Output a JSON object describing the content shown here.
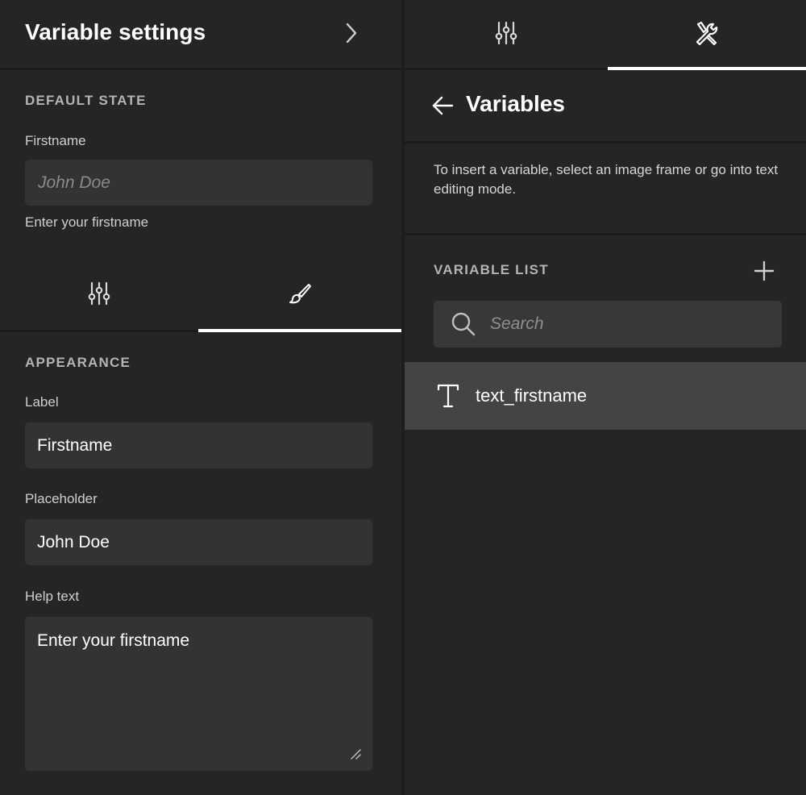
{
  "left_panel": {
    "title": "Variable settings",
    "default_state": {
      "heading": "DEFAULT STATE",
      "label": "Firstname",
      "placeholder": "John Doe",
      "help_text": "Enter your firstname"
    },
    "tabs": [
      {
        "icon": "sliders-icon",
        "active": false
      },
      {
        "icon": "paintbrush-icon",
        "active": true
      }
    ],
    "appearance": {
      "heading": "APPEARANCE",
      "label_field": {
        "label": "Label",
        "value": "Firstname"
      },
      "placeholder_field": {
        "label": "Placeholder",
        "value": "John Doe"
      },
      "help_text_field": {
        "label": "Help text",
        "value": "Enter your firstname"
      }
    }
  },
  "right_panel": {
    "tabs": [
      {
        "icon": "sliders-icon",
        "active": false
      },
      {
        "icon": "tools-icon",
        "active": true
      }
    ],
    "title": "Variables",
    "info": "To insert a variable, select an image frame or go into text editing mode.",
    "list_heading": "VARIABLE LIST",
    "search_placeholder": "Search",
    "variables": [
      {
        "type_icon": "text-type-icon",
        "name": "text_firstname"
      }
    ]
  }
}
